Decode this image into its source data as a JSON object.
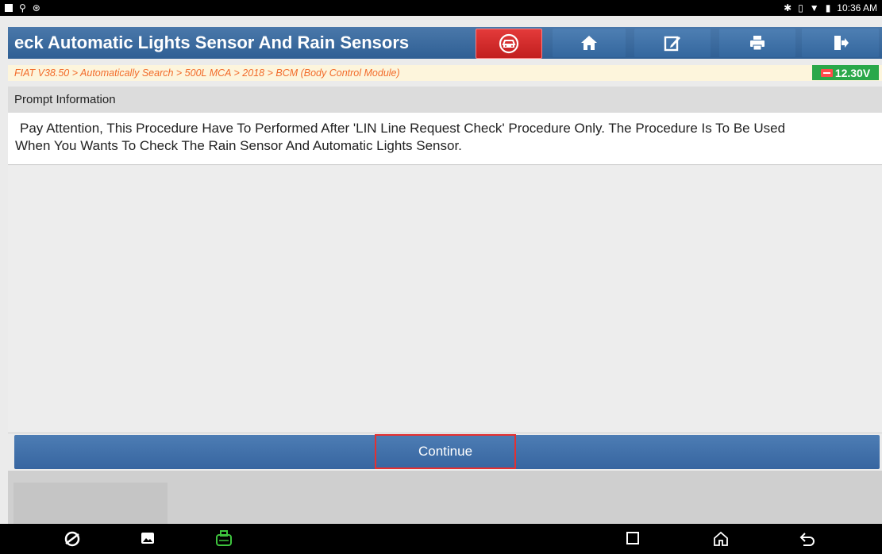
{
  "status_bar": {
    "time": "10:36 AM",
    "left_icons": [
      "image-icon",
      "usb-icon",
      "settings-icon"
    ],
    "right_icons": [
      "bluetooth-icon",
      "vibrate-icon",
      "wifi-icon",
      "battery-icon"
    ]
  },
  "header": {
    "title": "eck Automatic Lights Sensor And Rain Sensors",
    "buttons": [
      "car-diagnose-icon",
      "home-icon",
      "edit-icon",
      "print-icon",
      "exit-icon"
    ],
    "accent_red": "#d42828",
    "accent_blue": "#3a6aa0"
  },
  "breadcrumb": {
    "text": "FIAT V38.50 > Automatically Search > 500L MCA > 2018 > BCM (Body Control Module)"
  },
  "voltage": {
    "text": "12.30V",
    "color": "#2aa84a"
  },
  "prompt": {
    "heading": "Prompt Information",
    "line1": "Pay Attention, This Procedure Have To Performed After 'LIN Line Request Check' Procedure Only. The Procedure Is To Be Used",
    "line2": "When You Wants To Check The Rain Sensor And Automatic Lights Sensor."
  },
  "actions": {
    "continue_label": "Continue"
  },
  "nav_bar": {
    "icons": [
      "browser-icon",
      "gallery-icon",
      "vci-icon",
      "recent-apps-icon",
      "home-icon",
      "back-icon"
    ]
  }
}
